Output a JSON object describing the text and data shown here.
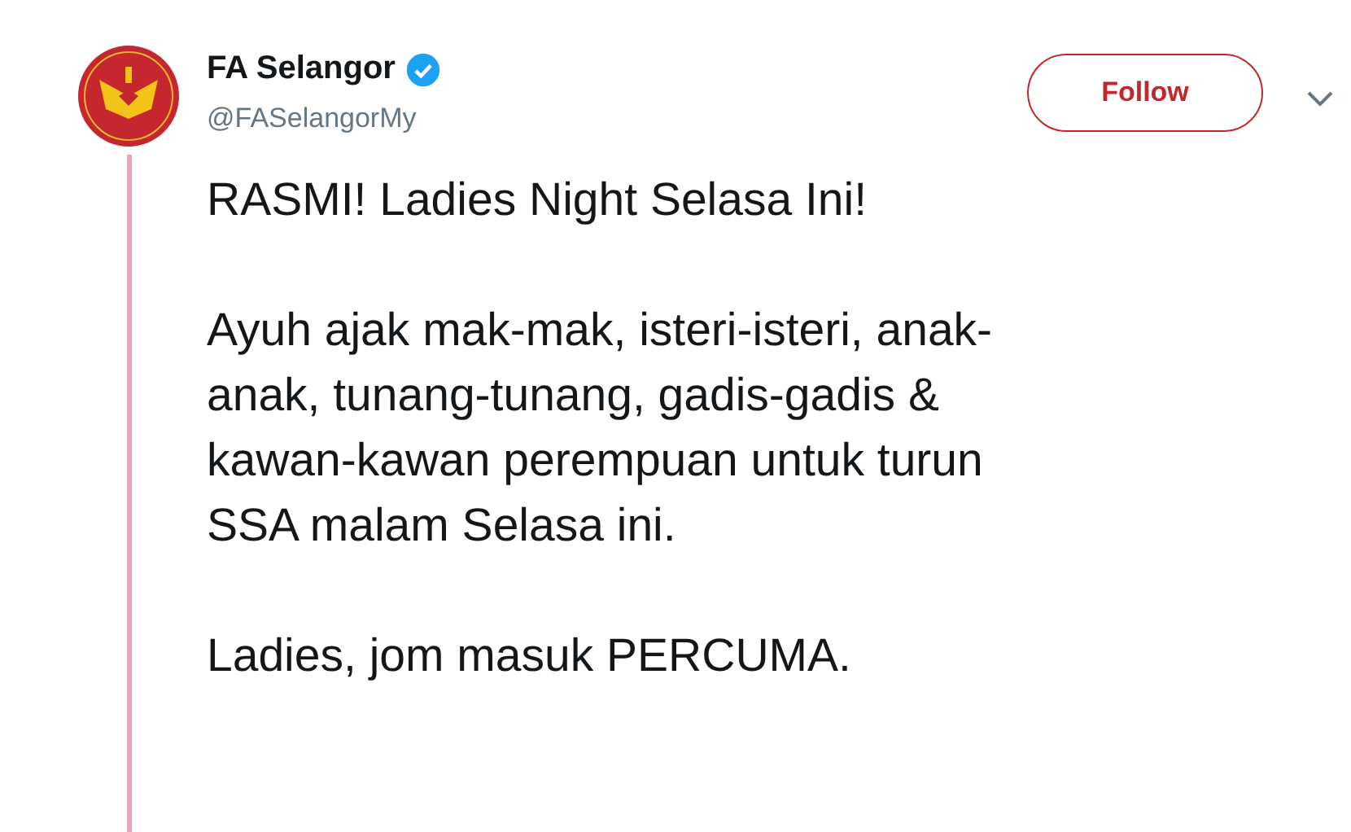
{
  "author": {
    "name": "FA Selangor",
    "verified": true,
    "handle": "@FASelangorMy"
  },
  "follow_button": {
    "label": "Follow"
  },
  "tweet": {
    "paragraphs": [
      {
        "lines": [
          "RASMI! Ladies Night Selasa Ini!"
        ]
      },
      {
        "lines": [
          "Ayuh ajak mak-mak, isteri-isteri, anak-",
          "anak, tunang-tunang, gadis-gadis &",
          "kawan-kawan perempuan untuk turun",
          "SSA malam Selasa ini."
        ]
      },
      {
        "lines": [
          "Ladies, jom masuk PERCUMA."
        ]
      }
    ]
  }
}
